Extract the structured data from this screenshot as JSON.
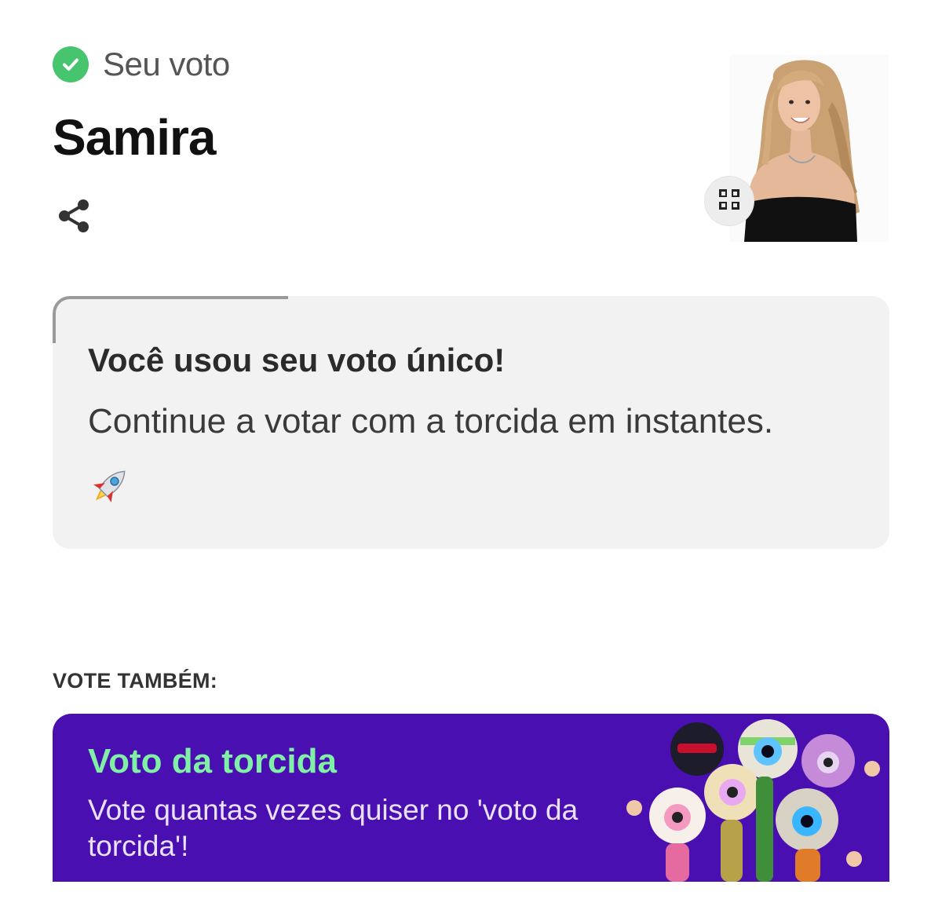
{
  "header": {
    "status_label": "Seu voto",
    "candidate_name": "Samira"
  },
  "icons": {
    "status": "check-circle-icon",
    "share": "share-icon",
    "expand": "expand-icon",
    "rocket": "rocket-icon"
  },
  "info_card": {
    "title": "Você usou seu voto único!",
    "body": "Continue a votar com a torcida em instantes."
  },
  "vote_also": {
    "label": "VOTE TAMBÉM:",
    "card": {
      "title": "Voto da torcida",
      "description": "Vote quantas vezes quiser no 'voto da torcida'!"
    }
  },
  "colors": {
    "check_green": "#46c46e",
    "card_bg": "#f2f2f2",
    "promo_bg": "#4a0fb0",
    "promo_title": "#7ff0a6"
  }
}
